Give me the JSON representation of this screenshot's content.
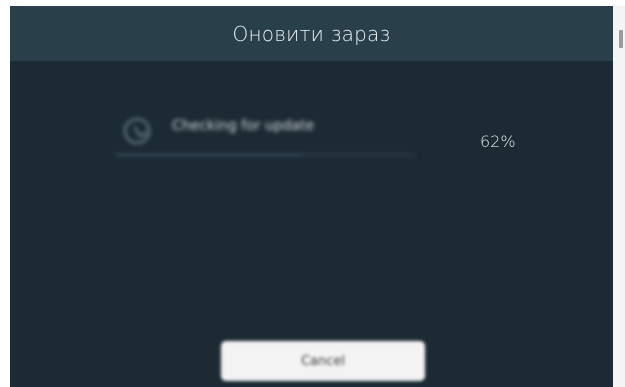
{
  "dialog": {
    "title": "Оновити зараз",
    "status_text": "Checking for update",
    "icon": "spinner-icon",
    "progress_percent": 62,
    "progress_label": "62%",
    "cancel_label": "Cancel"
  },
  "colors": {
    "background": "#1c2a33",
    "title_bar": "#29404b",
    "button": "#f3f3f3"
  }
}
